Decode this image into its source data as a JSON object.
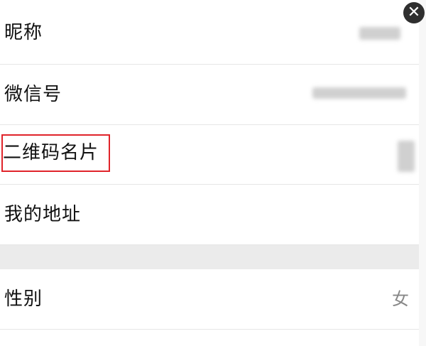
{
  "close_icon": "close-icon",
  "profile": {
    "rows": [
      {
        "label": "昵称"
      },
      {
        "label": "微信号"
      },
      {
        "label": "二维码名片"
      },
      {
        "label": "我的地址"
      }
    ],
    "gender": {
      "label": "性别",
      "value": "女"
    }
  },
  "colors": {
    "highlight_border": "#e0242a",
    "section_gap": "#ebebeb",
    "close_button": "#2f2f2f"
  }
}
